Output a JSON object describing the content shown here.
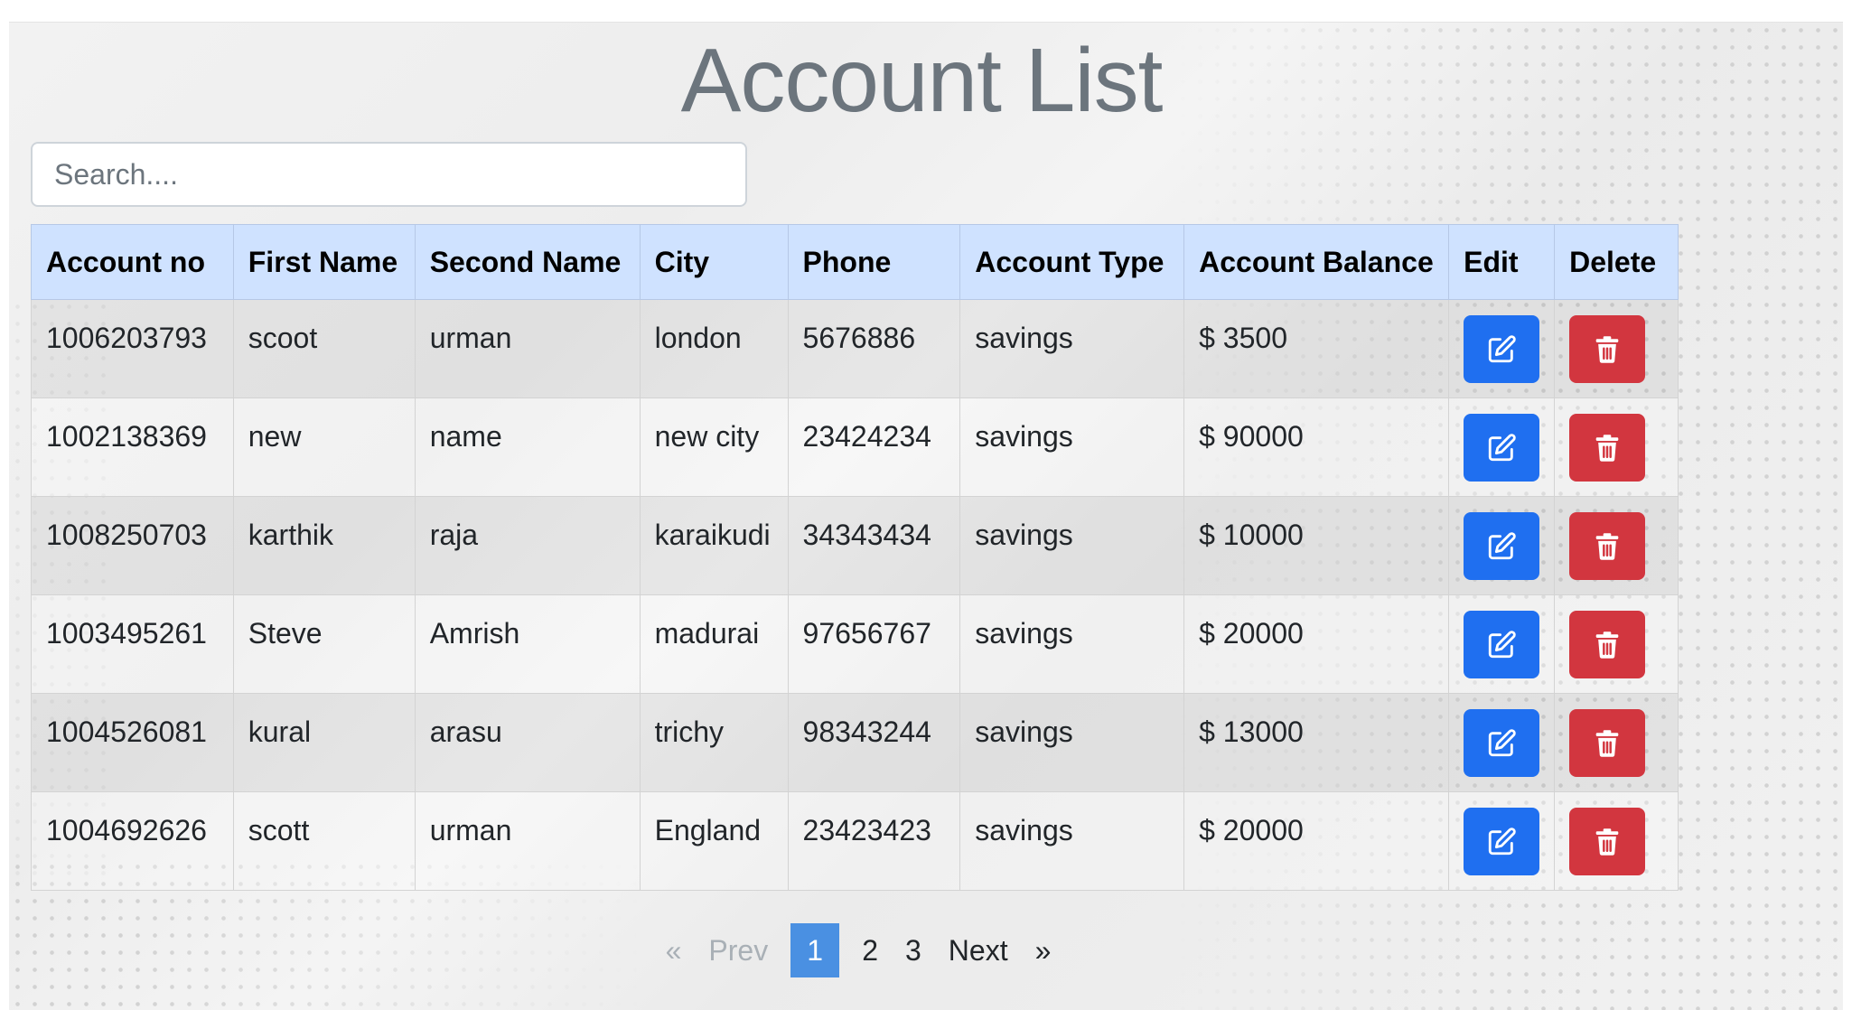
{
  "title": "Account List",
  "search": {
    "placeholder": "Search....",
    "value": ""
  },
  "table": {
    "headers": [
      "Account no",
      "First Name",
      "Second Name",
      "City",
      "Phone",
      "Account Type",
      "Account Balance",
      "Edit",
      "Delete"
    ],
    "rows": [
      {
        "account_no": "1006203793",
        "first_name": "scoot",
        "second_name": "urman",
        "city": "london",
        "phone": "5676886",
        "account_type": "savings",
        "balance": "$ 3500"
      },
      {
        "account_no": "1002138369",
        "first_name": "new",
        "second_name": "name",
        "city": "new city",
        "phone": "23424234",
        "account_type": "savings",
        "balance": "$ 90000"
      },
      {
        "account_no": "1008250703",
        "first_name": "karthik",
        "second_name": "raja",
        "city": "karaikudi",
        "phone": "34343434",
        "account_type": "savings",
        "balance": "$ 10000"
      },
      {
        "account_no": "1003495261",
        "first_name": "Steve",
        "second_name": "Amrish",
        "city": "madurai",
        "phone": "97656767",
        "account_type": "savings",
        "balance": "$ 20000"
      },
      {
        "account_no": "1004526081",
        "first_name": "kural",
        "second_name": "arasu",
        "city": "trichy",
        "phone": "98343244",
        "account_type": "savings",
        "balance": "$ 13000"
      },
      {
        "account_no": "1004692626",
        "first_name": "scott",
        "second_name": "urman",
        "city": "England",
        "phone": "23423423",
        "account_type": "savings",
        "balance": "$ 20000"
      }
    ],
    "edit_icon": "edit-icon",
    "delete_icon": "trash-icon"
  },
  "pagination": {
    "first_symbol": "«",
    "prev_label": "Prev",
    "pages": [
      "1",
      "2",
      "3"
    ],
    "active_page": "1",
    "next_label": "Next",
    "last_symbol": "»"
  },
  "colors": {
    "header_bg": "#cfe2ff",
    "edit_button": "#1f6ff0",
    "delete_button": "#d2363f",
    "active_page": "#4a90e2",
    "title": "#6c757d"
  }
}
